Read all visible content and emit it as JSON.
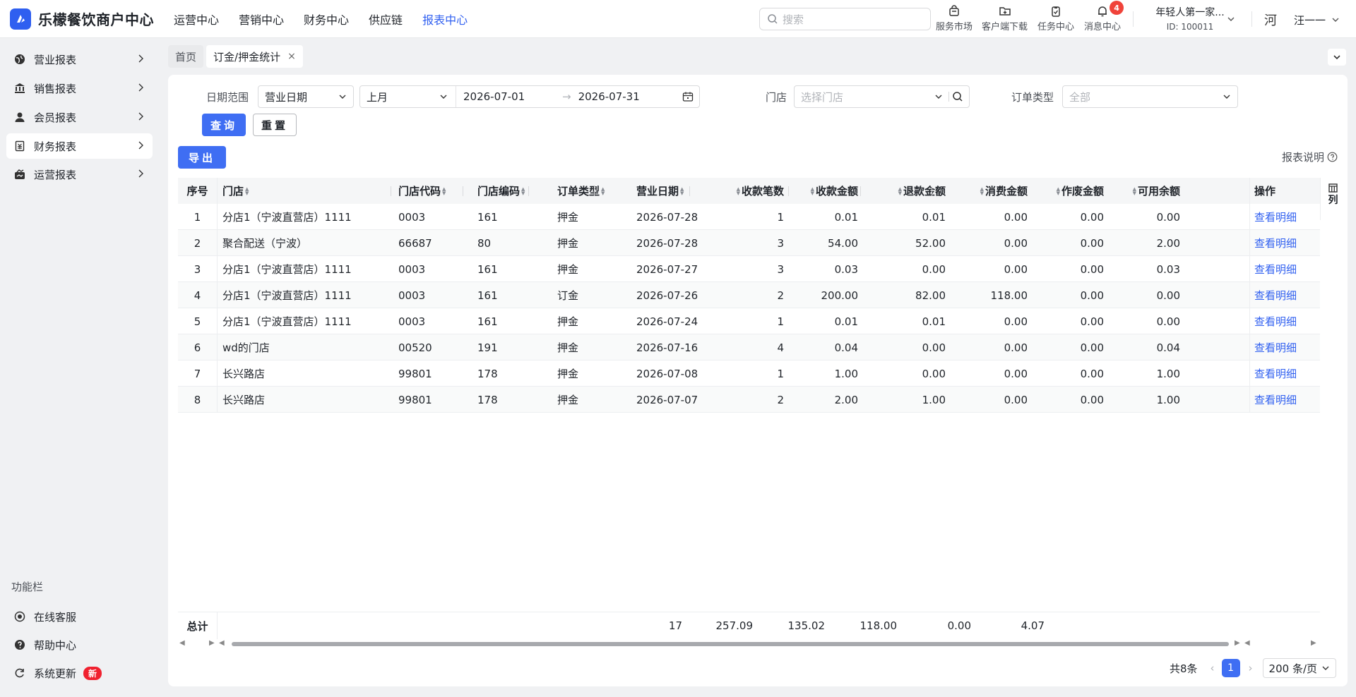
{
  "app": {
    "title": "乐檬餐饮商户中心"
  },
  "topnav": [
    "运营中心",
    "营销中心",
    "财务中心",
    "供应链",
    "报表中心"
  ],
  "search": {
    "placeholder": "搜索"
  },
  "tools": [
    {
      "label": "服务市场",
      "icon": "shop-bag-icon"
    },
    {
      "label": "客户端下载",
      "icon": "folder-download-icon"
    },
    {
      "label": "任务中心",
      "icon": "clipboard-icon"
    },
    {
      "label": "消息中心",
      "icon": "bell-icon",
      "badge": "4"
    }
  ],
  "account": {
    "name": "年轻人第一家...",
    "id": "ID: 100011"
  },
  "user": {
    "avatar": "河",
    "name": "汪一一"
  },
  "sidebar": {
    "items": [
      "营业报表",
      "销售报表",
      "会员报表",
      "财务报表",
      "运营报表"
    ],
    "func_title": "功能栏",
    "func_items": [
      "在线客服",
      "帮助中心",
      "系统更新"
    ],
    "new_badge": "新"
  },
  "tabs": {
    "home": "首页",
    "current": "订金/押金统计",
    "close": "×"
  },
  "filters": {
    "date_label": "日期范围",
    "date_type": "营业日期",
    "period": "上月",
    "start": "2026-07-01",
    "end": "2026-07-31",
    "store_label": "门店",
    "store_placeholder": "选择门店",
    "order_type_label": "订单类型",
    "order_type_value": "全部",
    "query": "查询",
    "reset": "重置",
    "export": "导出",
    "help": "报表说明"
  },
  "table": {
    "headers": [
      "序号",
      "门店",
      "门店代码",
      "门店编码",
      "订单类型",
      "营业日期",
      "收款笔数",
      "收款金额",
      "退款金额",
      "消费金额",
      "作废金额",
      "可用余额",
      "操作"
    ],
    "column_setting": "列",
    "rows": [
      [
        "1",
        "分店1（宁波直营店）1111",
        "0003",
        "161",
        "押金",
        "2026-07-28",
        "1",
        "0.01",
        "0.01",
        "0.00",
        "0.00",
        "0.00",
        "查看明细"
      ],
      [
        "2",
        "聚合配送（宁波）",
        "66687",
        "80",
        "押金",
        "2026-07-28",
        "3",
        "54.00",
        "52.00",
        "0.00",
        "0.00",
        "2.00",
        "查看明细"
      ],
      [
        "3",
        "分店1（宁波直营店）1111",
        "0003",
        "161",
        "押金",
        "2026-07-27",
        "3",
        "0.03",
        "0.00",
        "0.00",
        "0.00",
        "0.03",
        "查看明细"
      ],
      [
        "4",
        "分店1（宁波直营店）1111",
        "0003",
        "161",
        "订金",
        "2026-07-26",
        "2",
        "200.00",
        "82.00",
        "118.00",
        "0.00",
        "0.00",
        "查看明细"
      ],
      [
        "5",
        "分店1（宁波直营店）1111",
        "0003",
        "161",
        "押金",
        "2026-07-24",
        "1",
        "0.01",
        "0.01",
        "0.00",
        "0.00",
        "0.00",
        "查看明细"
      ],
      [
        "6",
        "wd的门店",
        "00520",
        "191",
        "押金",
        "2026-07-16",
        "4",
        "0.04",
        "0.00",
        "0.00",
        "0.00",
        "0.04",
        "查看明细"
      ],
      [
        "7",
        "长兴路店",
        "99801",
        "178",
        "押金",
        "2026-07-08",
        "1",
        "1.00",
        "0.00",
        "0.00",
        "0.00",
        "1.00",
        "查看明细"
      ],
      [
        "8",
        "长兴路店",
        "99801",
        "178",
        "押金",
        "2026-07-07",
        "2",
        "2.00",
        "1.00",
        "0.00",
        "0.00",
        "1.00",
        "查看明细"
      ]
    ],
    "total": {
      "label": "总计",
      "count": "17",
      "received": "257.09",
      "refund": "135.02",
      "consume": "118.00",
      "void": "0.00",
      "balance": "4.07"
    }
  },
  "pager": {
    "total": "共8条",
    "page": "1",
    "size": "200 条/页"
  },
  "colors": {
    "primary": "#3f6ef3",
    "link": "#2f5ff0",
    "badge": "#f0433a"
  }
}
